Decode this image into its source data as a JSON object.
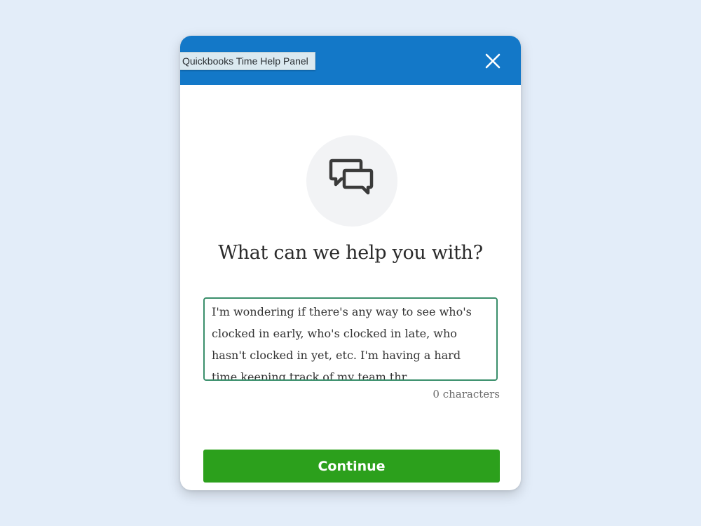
{
  "window": {
    "title": "Quickbooks Time Help Panel"
  },
  "icons": {
    "close": "close-icon",
    "chat": "chat-bubbles-icon"
  },
  "main": {
    "heading": "What can we help you with?",
    "question_value": "I'm wondering if there's any way to see who's clocked in early, who's clocked in late, who hasn't clocked in yet, etc. I'm having a hard time keeping track of my team thr",
    "char_count": "0 characters"
  },
  "footer": {
    "continue_label": "Continue"
  },
  "colors": {
    "header": "#1378c8",
    "primary_button": "#2ca01c",
    "input_border": "#3a8f6b",
    "background": "#e3edf9"
  }
}
